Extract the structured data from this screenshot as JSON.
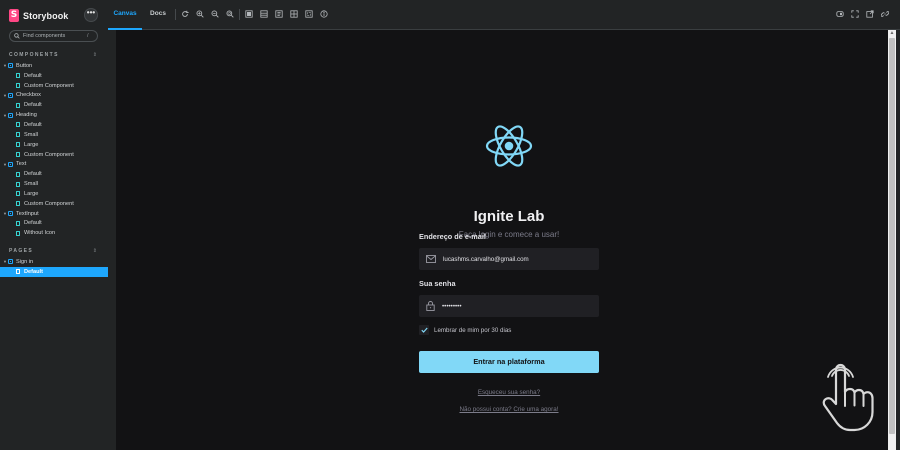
{
  "app": {
    "brand": "Storybook",
    "logo_letter": "S",
    "menu": "•••"
  },
  "search": {
    "placeholder": "Find components",
    "shortcut": "/"
  },
  "sidebar": {
    "components_heading": "COMPONENTS",
    "pages_heading": "PAGES",
    "collapse_glyph": "⇕",
    "components": [
      {
        "label": "Button",
        "stories": [
          "Default",
          "Custom Component"
        ]
      },
      {
        "label": "Checkbox",
        "stories": [
          "Default"
        ]
      },
      {
        "label": "Heading",
        "stories": [
          "Default",
          "Small",
          "Large",
          "Custom Component"
        ]
      },
      {
        "label": "Text",
        "stories": [
          "Default",
          "Small",
          "Large",
          "Custom Component"
        ]
      },
      {
        "label": "TextInput",
        "stories": [
          "Default",
          "Without Icon"
        ]
      }
    ],
    "pages": [
      {
        "label": "Sign in",
        "stories": [
          "Default"
        ],
        "selected_story": "Default"
      }
    ]
  },
  "toolbar": {
    "tabs": [
      {
        "label": "Canvas",
        "active": true
      },
      {
        "label": "Docs",
        "active": false
      }
    ],
    "tools": [
      "reload-icon",
      "zoom-in-icon",
      "zoom-out-icon",
      "zoom-reset-icon",
      "background-grid-icon",
      "viewport-icon",
      "measure-icon",
      "outline-icon",
      "layout-icon",
      "accessibility-icon"
    ],
    "right_tools": [
      "fullscreen-icon",
      "expand-icon",
      "open-new-tab-icon",
      "copy-link-icon"
    ]
  },
  "preview": {
    "title": "Ignite Lab",
    "subtitle": "Faça login e comece a usar!",
    "email": {
      "label": "Endereço de e-mail",
      "value": "lucashms.carvalho@gmail.com",
      "icon": "envelope-icon"
    },
    "password": {
      "label": "Sua senha",
      "value": "•••••••••",
      "icon": "lock-icon"
    },
    "remember": {
      "label": "Lembrar de mim por 30 dias",
      "checked": true
    },
    "submit_label": "Entrar na plataforma",
    "forgot_link": "Esqueceu sua senha?",
    "signup_link": "Não possui conta? Crie uma agora!"
  },
  "colors": {
    "accent": "#1ea7fd",
    "brand": "#ff4785",
    "react_logo": "#81d8f7",
    "button_bg": "#81d8f7",
    "canvas_bg": "#121214",
    "field_bg": "#202024"
  }
}
